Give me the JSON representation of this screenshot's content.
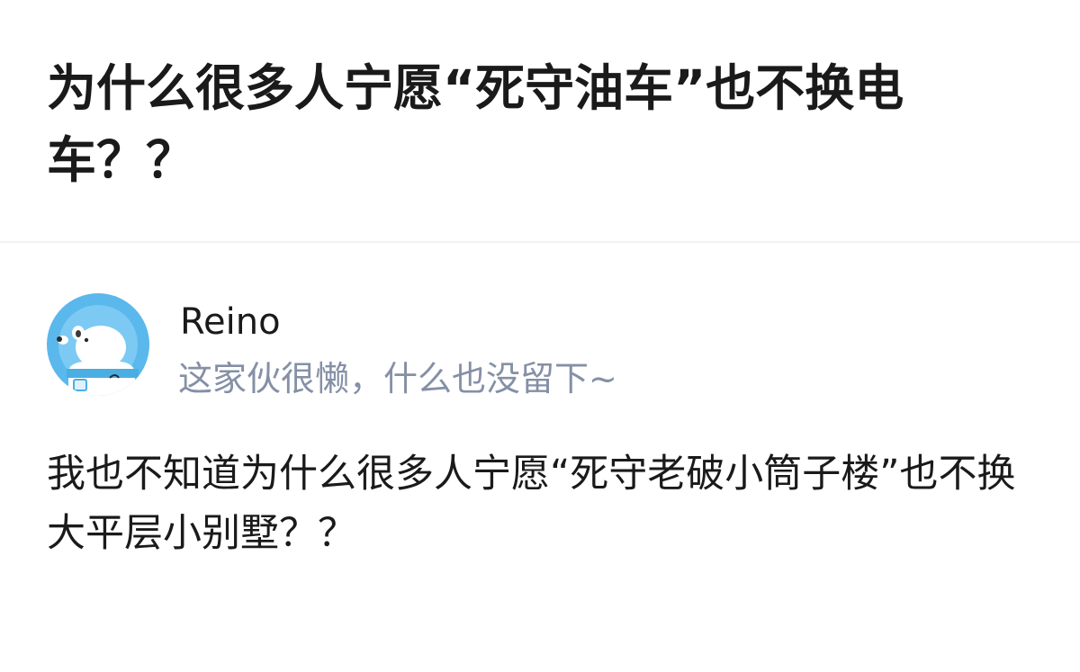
{
  "question": {
    "title": "为什么很多人宁愿“死守油车”也不换电车？？"
  },
  "author": {
    "name": "Reino",
    "bio": "这家伙很懒，什么也没留下~",
    "avatar_icon": "polar-bear-astronaut-icon"
  },
  "answer": {
    "content": "我也不知道为什么很多人宁愿“死守老破小筒子楼”也不换大平层小别墅？？"
  },
  "colors": {
    "title_text": "#1a1a1a",
    "bio_text": "#8590a6",
    "avatar_bg": "#5ab8ec",
    "divider": "#f2f2f2"
  }
}
